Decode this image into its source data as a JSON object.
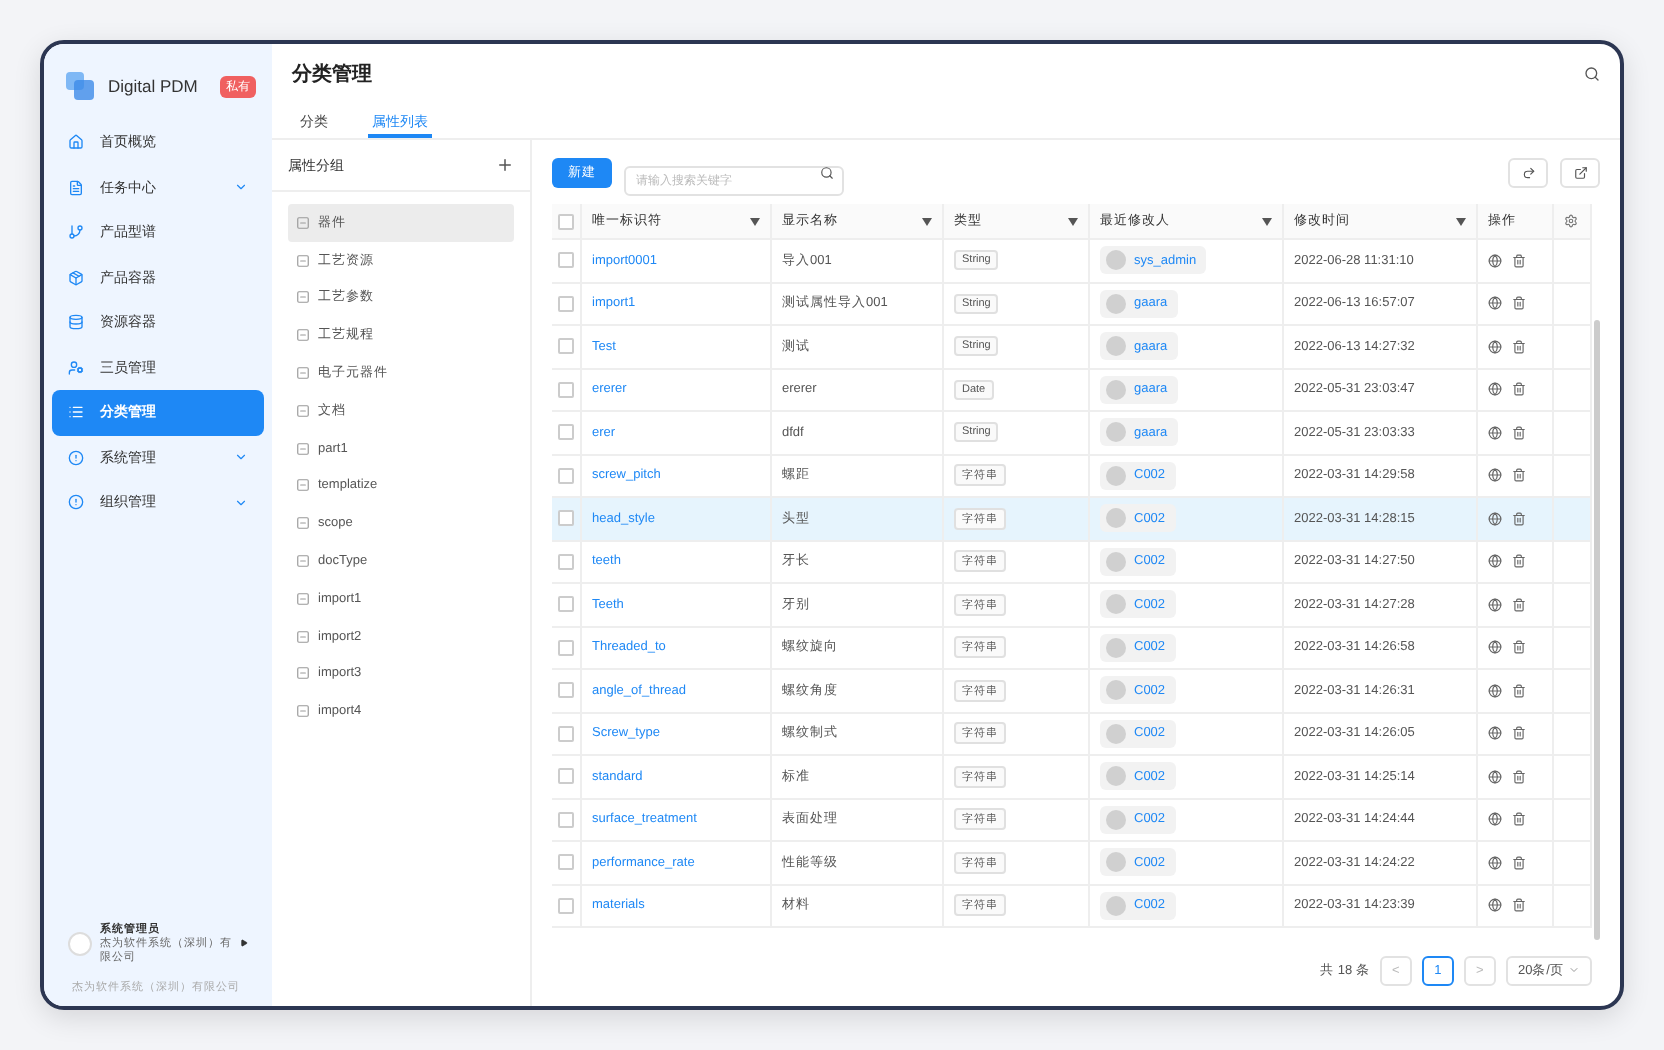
{
  "brand": {
    "name": "Digital PDM",
    "badge": "私有"
  },
  "sidebar": {
    "items": [
      {
        "label": "首页概览",
        "kind": "link",
        "selected": false
      },
      {
        "label": "任务中心",
        "kind": "group",
        "selected": false
      },
      {
        "label": "产品型谱",
        "kind": "link",
        "selected": false
      },
      {
        "label": "产品容器",
        "kind": "link",
        "selected": false
      },
      {
        "label": "资源容器",
        "kind": "link",
        "selected": false
      },
      {
        "label": "三员管理",
        "kind": "link",
        "selected": false
      },
      {
        "label": "分类管理",
        "kind": "link",
        "selected": true
      },
      {
        "label": "系统管理",
        "kind": "group",
        "selected": false
      },
      {
        "label": "组织管理",
        "kind": "group",
        "selected": false
      }
    ],
    "user": {
      "name": "系统管理员",
      "company": "杰为软件系统（深圳）有限公司"
    },
    "footer": "杰为软件系统（深圳）有限公司"
  },
  "page_title": "分类管理",
  "tabs": [
    {
      "label": "分类",
      "selected": false
    },
    {
      "label": "属性列表",
      "selected": true
    }
  ],
  "groups": {
    "title": "属性分组",
    "items": [
      {
        "label": "器件",
        "selected": true
      },
      {
        "label": "工艺资源",
        "selected": false
      },
      {
        "label": "工艺参数",
        "selected": false
      },
      {
        "label": "工艺规程",
        "selected": false
      },
      {
        "label": "电子元器件",
        "selected": false
      },
      {
        "label": "文档",
        "selected": false
      },
      {
        "label": "part1",
        "selected": false
      },
      {
        "label": "templatize",
        "selected": false
      },
      {
        "label": "scope",
        "selected": false
      },
      {
        "label": "docType",
        "selected": false
      },
      {
        "label": "import1",
        "selected": false
      },
      {
        "label": "import2",
        "selected": false
      },
      {
        "label": "import3",
        "selected": false
      },
      {
        "label": "import4",
        "selected": false
      }
    ]
  },
  "toolbar": {
    "new_button": "新建",
    "search": {
      "placeholder": "请输入搜索关键字"
    }
  },
  "table": {
    "all_checked": false,
    "columns": [
      "唯一标识符",
      "显示名称",
      "类型",
      "最近修改人",
      "修改时间",
      "操作"
    ],
    "rows": [
      {
        "id": "import0001",
        "name": "导入001",
        "type": "String",
        "user": "sys_admin",
        "time": "2022-06-28 11:31:10",
        "checked": false,
        "selected": false
      },
      {
        "id": "import1",
        "name": "测试属性导入001",
        "type": "String",
        "user": "gaara",
        "time": "2022-06-13 16:57:07",
        "checked": false,
        "selected": false
      },
      {
        "id": "Test",
        "name": "测试",
        "type": "String",
        "user": "gaara",
        "time": "2022-06-13 14:27:32",
        "checked": false,
        "selected": false
      },
      {
        "id": "ererer",
        "name": "ererer",
        "type": "Date",
        "user": "gaara",
        "time": "2022-05-31 23:03:47",
        "checked": false,
        "selected": false
      },
      {
        "id": "erer",
        "name": "dfdf",
        "type": "String",
        "user": "gaara",
        "time": "2022-05-31 23:03:33",
        "checked": false,
        "selected": false
      },
      {
        "id": "screw_pitch",
        "name": "螺距",
        "type": "字符串",
        "user": "C002",
        "time": "2022-03-31 14:29:58",
        "checked": false,
        "selected": false
      },
      {
        "id": "head_style",
        "name": "头型",
        "type": "字符串",
        "user": "C002",
        "time": "2022-03-31 14:28:15",
        "checked": false,
        "selected": true
      },
      {
        "id": "teeth",
        "name": "牙长",
        "type": "字符串",
        "user": "C002",
        "time": "2022-03-31 14:27:50",
        "checked": false,
        "selected": false
      },
      {
        "id": "Teeth",
        "name": "牙别",
        "type": "字符串",
        "user": "C002",
        "time": "2022-03-31 14:27:28",
        "checked": false,
        "selected": false
      },
      {
        "id": "Threaded_to",
        "name": "螺纹旋向",
        "type": "字符串",
        "user": "C002",
        "time": "2022-03-31 14:26:58",
        "checked": false,
        "selected": false
      },
      {
        "id": "angle_of_thread",
        "name": "螺纹角度",
        "type": "字符串",
        "user": "C002",
        "time": "2022-03-31 14:26:31",
        "checked": false,
        "selected": false
      },
      {
        "id": "Screw_type",
        "name": "螺纹制式",
        "type": "字符串",
        "user": "C002",
        "time": "2022-03-31 14:26:05",
        "checked": false,
        "selected": false
      },
      {
        "id": "standard",
        "name": "标准",
        "type": "字符串",
        "user": "C002",
        "time": "2022-03-31 14:25:14",
        "checked": false,
        "selected": false
      },
      {
        "id": "surface_treatment",
        "name": "表面处理",
        "type": "字符串",
        "user": "C002",
        "time": "2022-03-31 14:24:44",
        "checked": false,
        "selected": false
      },
      {
        "id": "performance_rate",
        "name": "性能等级",
        "type": "字符串",
        "user": "C002",
        "time": "2022-03-31 14:24:22",
        "checked": false,
        "selected": false
      },
      {
        "id": "materials",
        "name": "材料",
        "type": "字符串",
        "user": "C002",
        "time": "2022-03-31 14:23:39",
        "checked": false,
        "selected": false
      }
    ]
  },
  "pagination": {
    "total": "共 18 条",
    "prev": "<",
    "pages": [
      {
        "label": "1",
        "selected": true
      }
    ],
    "next": ">",
    "page_size": "20条/页"
  }
}
